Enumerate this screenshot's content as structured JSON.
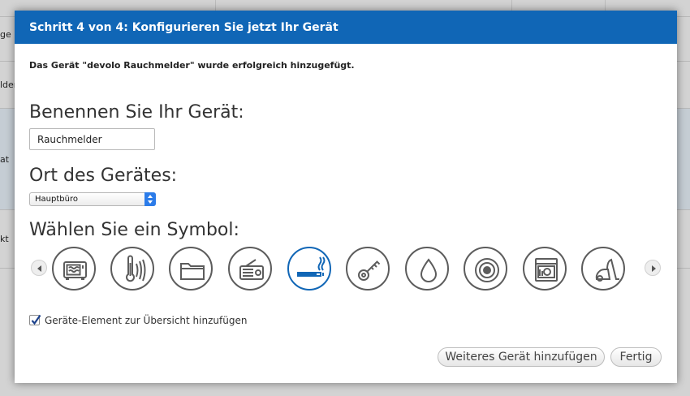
{
  "background": {
    "rows": [
      {
        "label": "ge"
      },
      {
        "label": "lder"
      },
      {
        "label": "at"
      },
      {
        "label": "kt"
      }
    ]
  },
  "dialog": {
    "title": "Schritt 4 von 4: Konfigurieren Sie jetzt Ihr Gerät",
    "success_message": "Das Gerät \"devolo Rauchmelder\" wurde erfolgreich hinzugefügt.",
    "name_heading": "Benennen Sie Ihr Gerät:",
    "name_value": "Rauchmelder",
    "location_heading": "Ort des Gerätes:",
    "location_selected": "Hauptbüro",
    "symbol_heading": "Wählen Sie ein Symbol:",
    "symbols": [
      {
        "icon": "microwave-icon"
      },
      {
        "icon": "thermometer-icon"
      },
      {
        "icon": "folder-icon"
      },
      {
        "icon": "radio-icon"
      },
      {
        "icon": "smoking-icon",
        "selected": true
      },
      {
        "icon": "key-icon"
      },
      {
        "icon": "water-drop-icon"
      },
      {
        "icon": "speaker-icon"
      },
      {
        "icon": "dishwasher-icon"
      },
      {
        "icon": "vacuum-icon"
      }
    ],
    "checkbox_label": "Geräte-Element zur Übersicht hinzufügen",
    "checkbox_checked": true,
    "add_another_label": "Weiteres Gerät hinzufügen",
    "finish_label": "Fertig",
    "colors": {
      "header": "#1066b6",
      "selected_symbol": "#1066b6",
      "icon_stroke": "#5c5c5c"
    }
  }
}
